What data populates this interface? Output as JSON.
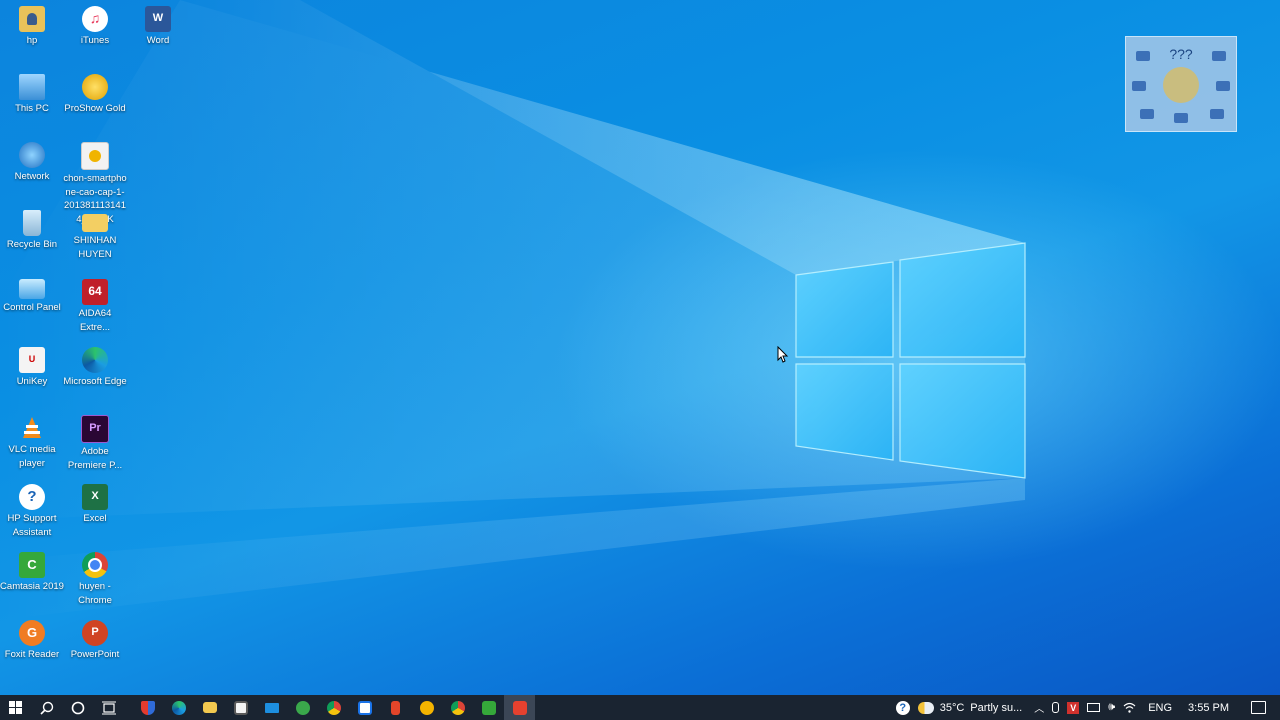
{
  "desktop_icons": {
    "hp": "hp",
    "itunes": "iTunes",
    "word": "Word",
    "this_pc": "This PC",
    "proshow": "ProShow Gold",
    "network": "Network",
    "chon_smartphone": "chon-smartphone-cao-cap-1-2013811131414_MYBK",
    "recycle_bin": "Recycle Bin",
    "shinhan": "SHINHAN HUYEN",
    "control_panel": "Control Panel",
    "aida64": "AIDA64 Extre...",
    "unikey": "UniKey",
    "edge": "Microsoft Edge",
    "vlc": "VLC media player",
    "premiere": "Adobe Premiere P...",
    "hp_support": "HP Support Assistant",
    "excel": "Excel",
    "camtasia": "Camtasia 2019",
    "chrome": "huyen - Chrome",
    "foxit": "Foxit Reader",
    "powerpoint": "PowerPoint"
  },
  "widget": {
    "text": "???"
  },
  "taskbar": {
    "weather_temp": "35°C",
    "weather_desc": "Partly su...",
    "language": "ENG",
    "time": "3:55 PM"
  },
  "colors": {
    "taskbar_bg": "#1a2431",
    "desktop_blue": "#0a8fe3",
    "logo_glow": "#7fe0ff"
  }
}
